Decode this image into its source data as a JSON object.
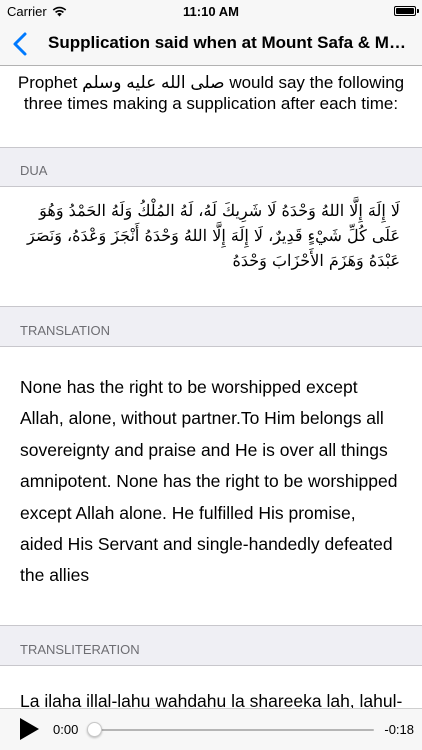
{
  "status_bar": {
    "carrier": "Carrier",
    "time": "11:10 AM",
    "battery_level": 1.0
  },
  "nav": {
    "title": "Supplication said when at Mount Safa & Mount Marwah"
  },
  "intro": {
    "text": "Prophet صلى الله عليه وسلم would say the following three times making a supplication after each time:"
  },
  "sections": {
    "dua_header": "DUA",
    "translation_header": "TRANSLATION",
    "transliteration_header": "TRANSLITERATION"
  },
  "dua": {
    "text": "لَا إِلَهَ إِلَّا اللهُ وَحْدَهُ لَا شَرِيكَ لَهُ، لَهُ المُلْكُ وَلَهُ الحَمْدُ وَهُوَ عَلَى كُلِّ شَيْءٍ قَدِيرٌ، لَا إِلَهَ إِلَّا اللهُ وَحْدَهُ أَنْجَزَ وَعْدَهُ، وَنَصَرَ عَبْدَهُ وَهَزَمَ الأَحْزَابَ وَحْدَهُ"
  },
  "translation": {
    "text": "None has the right to be worshipped except Allah, alone, without partner.To Him belongs all sovereignty and praise and He is over all things amnipotent. None has the right to be worshipped except Allah alone.  He fulfilled His promise, aided His Servant and single-handedly defeated the allies"
  },
  "transliteration": {
    "text": "La ilaha illal-lahu wahdahu la shareeka lah, lahul-"
  },
  "player": {
    "elapsed": "0:00",
    "remaining": "-0:18",
    "progress": 0.0
  },
  "colors": {
    "accent": "#007aff",
    "section_bg": "#efeff4",
    "section_text": "#6d6d72",
    "bar_bg": "#f7f7f7"
  },
  "icons": {
    "back": "chevron-left-icon",
    "play": "play-icon",
    "wifi": "wifi-icon",
    "battery": "battery-icon"
  }
}
